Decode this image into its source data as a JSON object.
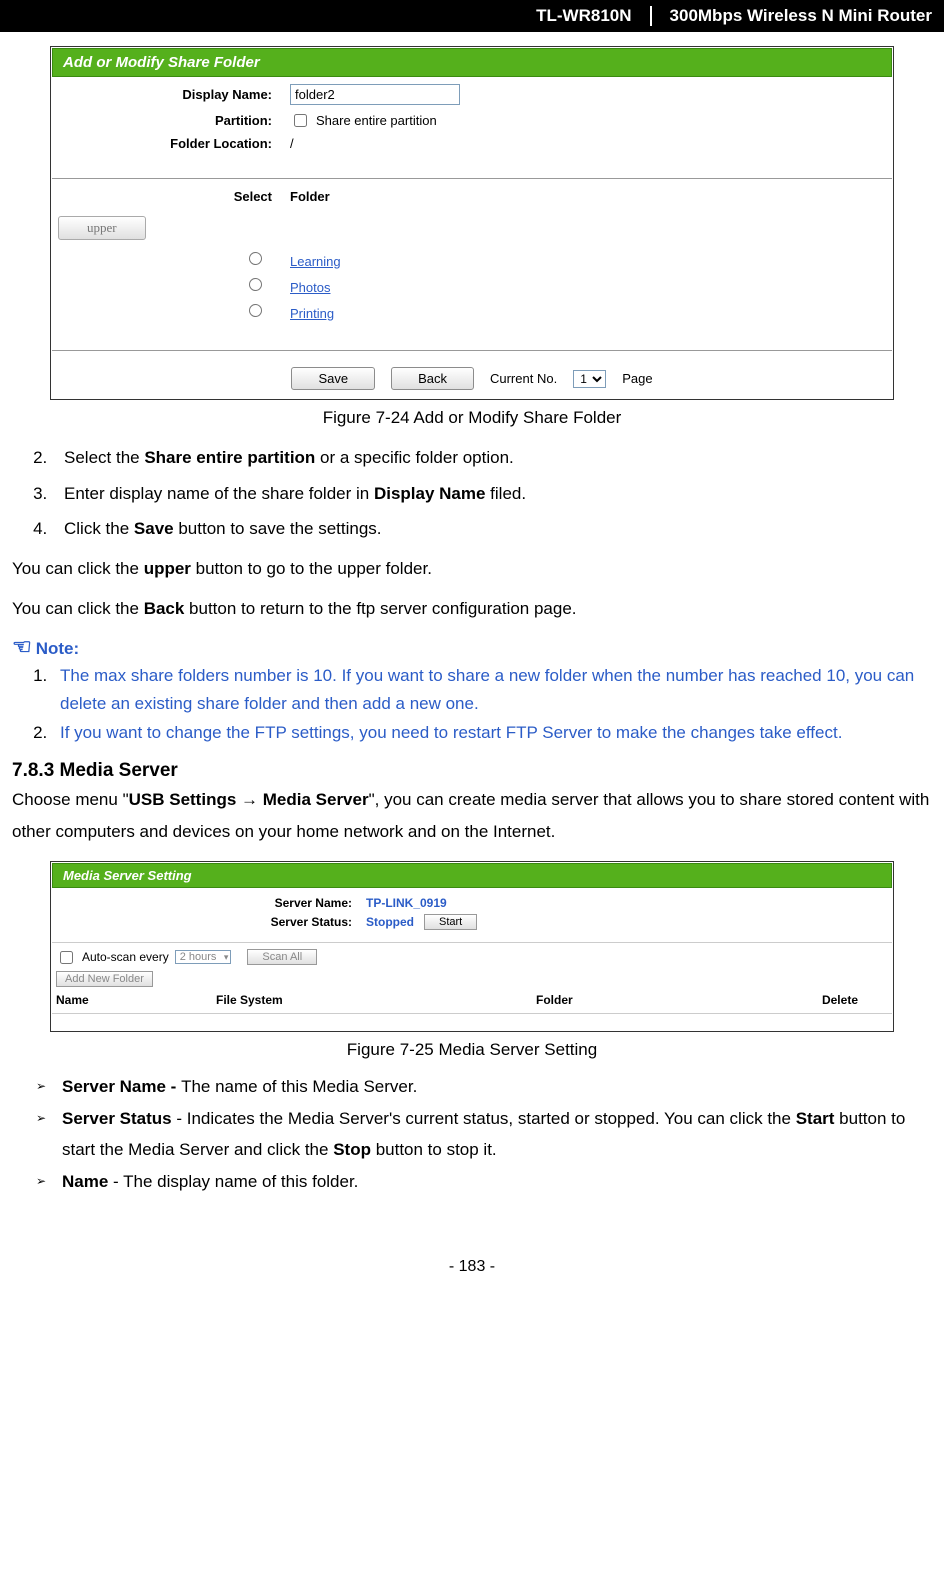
{
  "header": {
    "model": "TL-WR810N",
    "product": "300Mbps Wireless N Mini Router"
  },
  "figure1": {
    "title": "Add or Modify Share Folder",
    "display_name_label": "Display Name:",
    "display_name_value": "folder2",
    "partition_label": "Partition:",
    "partition_checkbox_text": "Share entire partition",
    "folder_location_label": "Folder Location:",
    "folder_location_value": "/",
    "col_select": "Select",
    "col_folder": "Folder",
    "upper_btn": "upper",
    "folders": [
      "Learning",
      "Photos",
      "Printing"
    ],
    "save_btn": "Save",
    "back_btn": "Back",
    "current_no_label": "Current No.",
    "page_value": "1",
    "page_suffix": "Page",
    "caption": "Figure 7-24 Add or Modify Share Folder"
  },
  "steps": {
    "s2_a": "Select the ",
    "s2_b": "Share entire partition",
    "s2_c": " or a specific folder option.",
    "s3_a": "Enter display name of the share folder in ",
    "s3_b": "Display Name",
    "s3_c": " filed.",
    "s4_a": "Click the ",
    "s4_b": "Save",
    "s4_c": " button to save the settings."
  },
  "para1": {
    "a": "You can click the ",
    "b": "upper",
    "c": " button to go to the upper folder."
  },
  "para2": {
    "a": "You can click the ",
    "b": "Back",
    "c": " button to return to the ftp server configuration page."
  },
  "note_title": "Note:",
  "notes": {
    "n1": "The max share folders number is 10. If you want to share a new folder when the number has reached 10, you can delete an existing share folder and then add a new one.",
    "n2": "If you want to change the FTP settings, you need to restart FTP Server to make the changes take effect."
  },
  "section": "7.8.3   Media Server",
  "section_intro": {
    "a": "Choose menu \"",
    "b": "USB Settings",
    "arrow": " → ",
    "c": "Media Server",
    "d": "\", you can create media server that allows you to share stored content with other computers and devices on your home network and on the Internet."
  },
  "figure2": {
    "title": "Media Server Setting",
    "server_name_label": "Server Name:",
    "server_name_value": "TP-LINK_0919",
    "server_status_label": "Server Status:",
    "server_status_value": "Stopped",
    "start_btn": "Start",
    "autoscan_label": "Auto-scan every",
    "autoscan_value": "2 hours",
    "scan_all_btn": "Scan All",
    "add_folder_btn": "Add New Folder",
    "col_name": "Name",
    "col_fs": "File System",
    "col_folder": "Folder",
    "col_delete": "Delete",
    "caption": "Figure 7-25 Media Server Setting"
  },
  "bullets": {
    "b1": {
      "a": "Server Name - ",
      "b": "The name of this Media Server."
    },
    "b2": {
      "a": "Server Status",
      "b": " - Indicates the Media Server's current status, started or stopped. You can click the ",
      "c": "Start",
      "d": " button to start the Media Server and click the ",
      "e": "Stop",
      "f": " button to stop it."
    },
    "b3": {
      "a": "Name",
      "b": " - The display name of this folder."
    }
  },
  "footer": "- 183 -"
}
